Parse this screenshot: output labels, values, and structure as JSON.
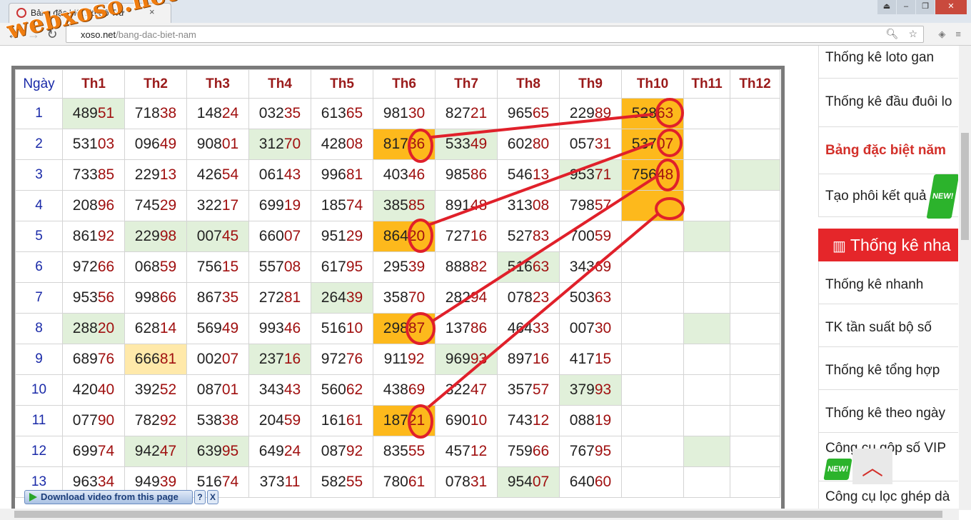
{
  "browser": {
    "tab_title": "Bảng đặc biệt Xổ Số Trư",
    "tab_close": "×",
    "url_host": "xoso.net",
    "url_path": "/bang-dac-biet-nam",
    "watermark": "webxoso.net",
    "window_controls": [
      "⏏",
      "–",
      "❐",
      "✕"
    ]
  },
  "table": {
    "day_header": "Ngày",
    "month_headers": [
      "Th1",
      "Th2",
      "Th3",
      "Th4",
      "Th5",
      "Th6",
      "Th7",
      "Th8",
      "Th9",
      "Th10",
      "Th11",
      "Th12"
    ],
    "rows": [
      {
        "day": "1",
        "cells": [
          [
            "489",
            "51",
            "green"
          ],
          [
            "718",
            "38",
            ""
          ],
          [
            "148",
            "24",
            ""
          ],
          [
            "032",
            "35",
            ""
          ],
          [
            "613",
            "65",
            ""
          ],
          [
            "981",
            "30",
            ""
          ],
          [
            "827",
            "21",
            ""
          ],
          [
            "965",
            "65",
            ""
          ],
          [
            "229",
            "89",
            ""
          ],
          [
            "528",
            "63",
            "orange"
          ],
          [
            "",
            "",
            ""
          ],
          [
            "",
            "",
            ""
          ]
        ]
      },
      {
        "day": "2",
        "cells": [
          [
            "531",
            "03",
            ""
          ],
          [
            "096",
            "49",
            ""
          ],
          [
            "908",
            "01",
            ""
          ],
          [
            "312",
            "70",
            "green"
          ],
          [
            "428",
            "08",
            ""
          ],
          [
            "817",
            "36",
            "orange"
          ],
          [
            "533",
            "49",
            "green"
          ],
          [
            "602",
            "80",
            ""
          ],
          [
            "057",
            "31",
            ""
          ],
          [
            "537",
            "07",
            "orange"
          ],
          [
            "",
            "",
            ""
          ],
          [
            "",
            "",
            ""
          ]
        ]
      },
      {
        "day": "3",
        "cells": [
          [
            "733",
            "85",
            ""
          ],
          [
            "229",
            "13",
            ""
          ],
          [
            "426",
            "54",
            ""
          ],
          [
            "061",
            "43",
            ""
          ],
          [
            "996",
            "81",
            ""
          ],
          [
            "403",
            "46",
            ""
          ],
          [
            "985",
            "86",
            ""
          ],
          [
            "546",
            "13",
            ""
          ],
          [
            "953",
            "71",
            "green"
          ],
          [
            "756",
            "48",
            "orange"
          ],
          [
            "",
            "",
            ""
          ],
          [
            "",
            "",
            "green"
          ]
        ]
      },
      {
        "day": "4",
        "cells": [
          [
            "208",
            "96",
            ""
          ],
          [
            "745",
            "29",
            ""
          ],
          [
            "322",
            "17",
            ""
          ],
          [
            "699",
            "19",
            ""
          ],
          [
            "185",
            "74",
            ""
          ],
          [
            "385",
            "85",
            "green"
          ],
          [
            "891",
            "48",
            ""
          ],
          [
            "313",
            "08",
            ""
          ],
          [
            "798",
            "57",
            ""
          ],
          [
            "",
            "",
            "orange"
          ],
          [
            "",
            "",
            ""
          ],
          [
            "",
            "",
            ""
          ]
        ]
      },
      {
        "day": "5",
        "cells": [
          [
            "861",
            "92",
            ""
          ],
          [
            "229",
            "98",
            "green"
          ],
          [
            "007",
            "45",
            "green"
          ],
          [
            "660",
            "07",
            ""
          ],
          [
            "951",
            "29",
            ""
          ],
          [
            "864",
            "20",
            "orange"
          ],
          [
            "727",
            "16",
            ""
          ],
          [
            "527",
            "83",
            ""
          ],
          [
            "700",
            "59",
            ""
          ],
          [
            "",
            "",
            ""
          ],
          [
            "",
            "",
            "green"
          ],
          [
            "",
            "",
            ""
          ]
        ]
      },
      {
        "day": "6",
        "cells": [
          [
            "972",
            "66",
            ""
          ],
          [
            "068",
            "59",
            ""
          ],
          [
            "756",
            "15",
            ""
          ],
          [
            "557",
            "08",
            ""
          ],
          [
            "617",
            "95",
            ""
          ],
          [
            "295",
            "39",
            ""
          ],
          [
            "888",
            "82",
            ""
          ],
          [
            "516",
            "63",
            "green"
          ],
          [
            "343",
            "69",
            ""
          ],
          [
            "",
            "",
            ""
          ],
          [
            "",
            "",
            ""
          ],
          [
            "",
            "",
            ""
          ]
        ]
      },
      {
        "day": "7",
        "cells": [
          [
            "953",
            "56",
            ""
          ],
          [
            "998",
            "66",
            ""
          ],
          [
            "867",
            "35",
            ""
          ],
          [
            "272",
            "81",
            ""
          ],
          [
            "264",
            "39",
            "green"
          ],
          [
            "358",
            "70",
            ""
          ],
          [
            "282",
            "94",
            ""
          ],
          [
            "078",
            "23",
            ""
          ],
          [
            "503",
            "63",
            ""
          ],
          [
            "",
            "",
            ""
          ],
          [
            "",
            "",
            ""
          ],
          [
            "",
            "",
            ""
          ]
        ]
      },
      {
        "day": "8",
        "cells": [
          [
            "288",
            "20",
            "green"
          ],
          [
            "628",
            "14",
            ""
          ],
          [
            "569",
            "49",
            ""
          ],
          [
            "993",
            "46",
            ""
          ],
          [
            "516",
            "10",
            ""
          ],
          [
            "298",
            "87",
            "orange"
          ],
          [
            "137",
            "86",
            ""
          ],
          [
            "464",
            "33",
            ""
          ],
          [
            "007",
            "30",
            ""
          ],
          [
            "",
            "",
            ""
          ],
          [
            "",
            "",
            "green"
          ],
          [
            "",
            "",
            ""
          ]
        ]
      },
      {
        "day": "9",
        "cells": [
          [
            "689",
            "76",
            ""
          ],
          [
            "666",
            "81",
            "yellow"
          ],
          [
            "002",
            "07",
            ""
          ],
          [
            "237",
            "16",
            "green"
          ],
          [
            "972",
            "76",
            ""
          ],
          [
            "911",
            "92",
            ""
          ],
          [
            "969",
            "93",
            "green"
          ],
          [
            "897",
            "16",
            ""
          ],
          [
            "417",
            "15",
            ""
          ],
          [
            "",
            "",
            ""
          ],
          [
            "",
            "",
            ""
          ],
          [
            "",
            "",
            ""
          ]
        ]
      },
      {
        "day": "10",
        "cells": [
          [
            "420",
            "40",
            ""
          ],
          [
            "392",
            "52",
            ""
          ],
          [
            "087",
            "01",
            ""
          ],
          [
            "343",
            "43",
            ""
          ],
          [
            "560",
            "62",
            ""
          ],
          [
            "438",
            "69",
            ""
          ],
          [
            "322",
            "47",
            ""
          ],
          [
            "357",
            "57",
            ""
          ],
          [
            "379",
            "93",
            "green"
          ],
          [
            "",
            "",
            ""
          ],
          [
            "",
            "",
            ""
          ],
          [
            "",
            "",
            ""
          ]
        ]
      },
      {
        "day": "11",
        "cells": [
          [
            "077",
            "90",
            ""
          ],
          [
            "782",
            "92",
            ""
          ],
          [
            "538",
            "38",
            ""
          ],
          [
            "204",
            "59",
            ""
          ],
          [
            "161",
            "61",
            ""
          ],
          [
            "187",
            "21",
            "orange"
          ],
          [
            "690",
            "10",
            ""
          ],
          [
            "743",
            "12",
            ""
          ],
          [
            "088",
            "19",
            ""
          ],
          [
            "",
            "",
            ""
          ],
          [
            "",
            "",
            ""
          ],
          [
            "",
            "",
            ""
          ]
        ]
      },
      {
        "day": "12",
        "cells": [
          [
            "699",
            "74",
            ""
          ],
          [
            "942",
            "47",
            "green"
          ],
          [
            "639",
            "95",
            "green"
          ],
          [
            "649",
            "24",
            ""
          ],
          [
            "087",
            "92",
            ""
          ],
          [
            "835",
            "55",
            ""
          ],
          [
            "457",
            "12",
            ""
          ],
          [
            "759",
            "66",
            ""
          ],
          [
            "767",
            "95",
            ""
          ],
          [
            "",
            "",
            ""
          ],
          [
            "",
            "",
            "green"
          ],
          [
            "",
            "",
            ""
          ]
        ]
      },
      {
        "day": "13",
        "cells": [
          [
            "963",
            "34",
            ""
          ],
          [
            "949",
            "39",
            ""
          ],
          [
            "516",
            "74",
            ""
          ],
          [
            "373",
            "11",
            ""
          ],
          [
            "582",
            "55",
            ""
          ],
          [
            "780",
            "61",
            ""
          ],
          [
            "078",
            "31",
            ""
          ],
          [
            "954",
            "07",
            "green"
          ],
          [
            "640",
            "60",
            ""
          ],
          [
            "",
            "",
            ""
          ],
          [
            "",
            "",
            ""
          ],
          [
            "",
            "",
            ""
          ]
        ]
      }
    ]
  },
  "sidebar": {
    "items_top": [
      "Thống kê loto gan",
      "Thống kê đầu đuôi lo",
      "Bảng đặc biệt năm",
      "Tạo phôi kết quả"
    ],
    "active_index": 2,
    "header": "Thống kê nha",
    "items_bottom": [
      "Thống kê nhanh",
      "TK tần suất bộ số",
      "Thống kê tổng hợp",
      "Thống kê theo ngày",
      "Công cụ gộp số VIP",
      "Công cụ lọc ghép dà"
    ],
    "new_badge": "NEW!"
  },
  "download_bar": {
    "label": "Download video from this page",
    "help": "?",
    "close": "X"
  },
  "colors": {
    "highlight_orange": "#fdb91c",
    "highlight_green": "#e1f0da",
    "annotation_red": "#e0202a",
    "accent_red": "#e5262a"
  }
}
